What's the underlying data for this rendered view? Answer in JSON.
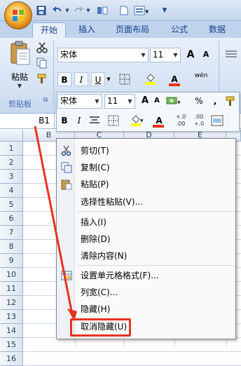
{
  "quick_access": {
    "save_icon": "save-icon",
    "undo_icon": "undo-icon",
    "redo_icon": "redo-icon"
  },
  "tabs": [
    {
      "label": "开始",
      "active": true
    },
    {
      "label": "插入",
      "active": false
    },
    {
      "label": "页面布局",
      "active": false
    },
    {
      "label": "公式",
      "active": false
    },
    {
      "label": "数据",
      "active": false
    }
  ],
  "ribbon": {
    "clipboard": {
      "paste_label": "粘贴",
      "group_label": "剪贴板"
    },
    "font": {
      "name": "宋体",
      "size": "11",
      "increase_label": "A",
      "decrease_label": "A",
      "bold": "B",
      "italic": "I",
      "underline": "U",
      "font_color_label": "A",
      "phonetic_label": "wén"
    }
  },
  "minibar": {
    "font_name": "宋体",
    "font_size": "11",
    "grow": "A",
    "shrink": "A",
    "percent": "%",
    "comma": ",",
    "bold": "B",
    "italic": "I",
    "font_color": "A",
    "inc_decimal": "+.0\n.00",
    "dec_decimal": ".00\n+.0"
  },
  "formula_bar": {
    "name_box": "B1"
  },
  "grid": {
    "columns": [
      "B",
      "C",
      "D",
      "E"
    ],
    "rows": [
      "1",
      "2",
      "3",
      "4",
      "5",
      "6",
      "7",
      "8",
      "9",
      "10",
      "11",
      "12",
      "13",
      "14",
      "15",
      "16"
    ]
  },
  "context_menu": {
    "items": [
      {
        "label": "剪切(T)",
        "icon": "scissors-icon"
      },
      {
        "label": "复制(C)",
        "icon": "copy-icon"
      },
      {
        "label": "粘贴(P)",
        "icon": "paste-icon"
      },
      {
        "label": "选择性粘贴(V)...",
        "icon": ""
      },
      {
        "label": "插入(I)",
        "icon": ""
      },
      {
        "label": "删除(D)",
        "icon": ""
      },
      {
        "label": "清除内容(N)",
        "icon": ""
      },
      {
        "label": "设置单元格格式(F)...",
        "icon": "format-cells-icon"
      },
      {
        "label": "列宽(C)...",
        "icon": ""
      },
      {
        "label": "隐藏(H)",
        "icon": ""
      },
      {
        "label": "取消隐藏(U)",
        "icon": ""
      }
    ]
  },
  "annotation_color": "#e8321d"
}
